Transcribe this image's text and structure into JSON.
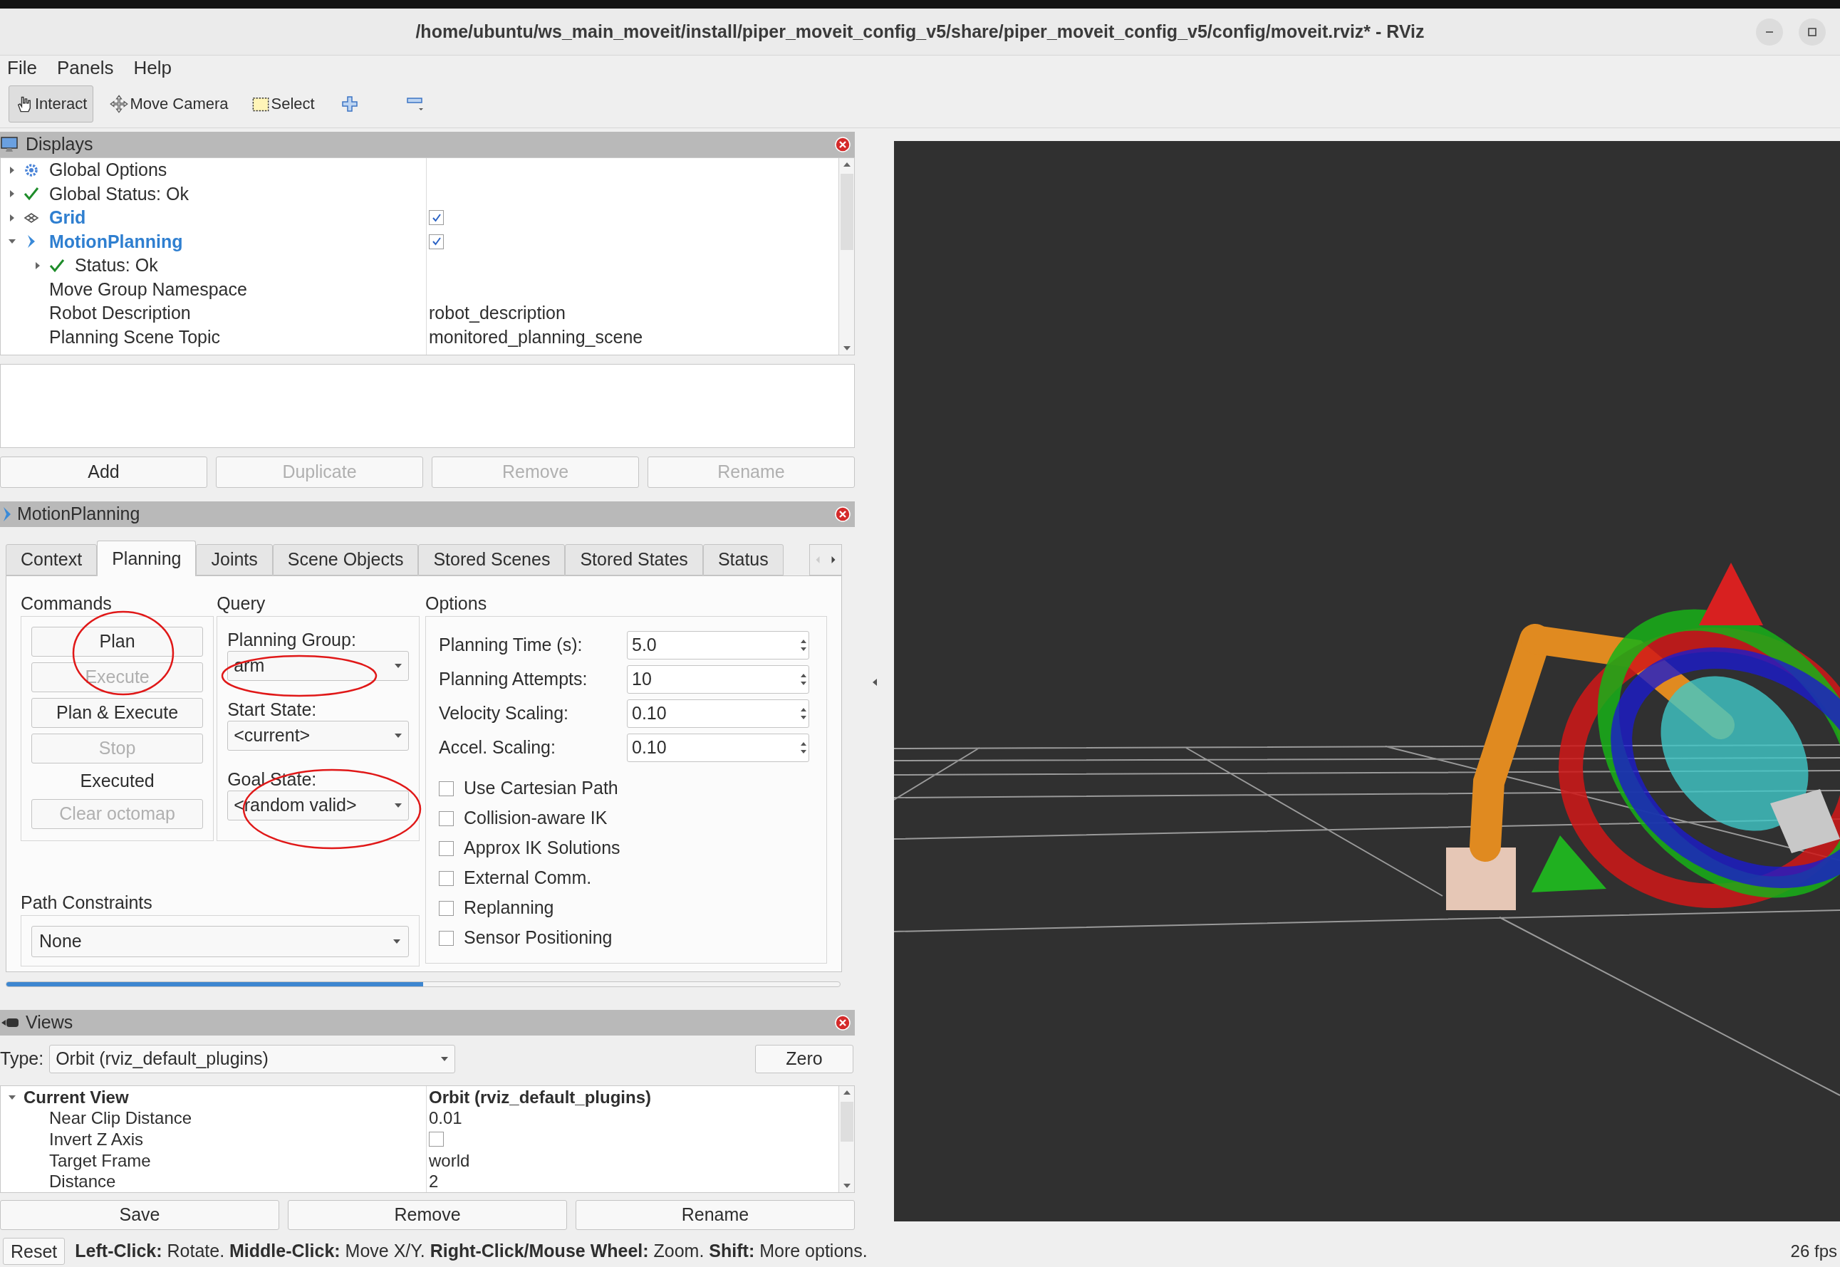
{
  "window": {
    "title": "/home/ubuntu/ws_main_moveit/install/piper_moveit_config_v5/share/piper_moveit_config_v5/config/moveit.rviz* - RViz"
  },
  "menu": [
    "File",
    "Panels",
    "Help"
  ],
  "toolbar": [
    {
      "kind": "interact",
      "label": "Interact",
      "selected": true
    },
    {
      "kind": "move",
      "label": "Move Camera",
      "selected": false
    },
    {
      "kind": "select",
      "label": "Select",
      "selected": false
    },
    {
      "kind": "plus"
    },
    {
      "kind": "minus"
    }
  ],
  "displays": {
    "title": "Displays",
    "tree": [
      {
        "label": "Global Options",
        "kind": "gear",
        "expanded": false
      },
      {
        "label": "Global Status: Ok",
        "kind": "status",
        "expanded": false
      },
      {
        "label": "Grid",
        "kind": "grid",
        "expanded": false,
        "checked": true
      },
      {
        "label": "MotionPlanning",
        "kind": "motion",
        "expanded": true,
        "checked": true,
        "children": [
          {
            "label": "Status: Ok",
            "kind": "status",
            "expanded": false
          },
          {
            "label": "Move Group Namespace"
          },
          {
            "label": "Robot Description",
            "value": "robot_description"
          },
          {
            "label": "Planning Scene Topic",
            "value": "monitored_planning_scene"
          }
        ]
      }
    ],
    "buttons": [
      {
        "label": "Add",
        "disabled": false
      },
      {
        "label": "Duplicate",
        "disabled": true
      },
      {
        "label": "Remove",
        "disabled": true
      },
      {
        "label": "Rename",
        "disabled": true
      }
    ]
  },
  "motion_planning": {
    "title": "MotionPlanning",
    "tabs": [
      {
        "label": "Context",
        "selected": false
      },
      {
        "label": "Planning",
        "selected": true
      },
      {
        "label": "Joints",
        "selected": false
      },
      {
        "label": "Scene Objects",
        "selected": false
      },
      {
        "label": "Stored Scenes",
        "selected": false
      },
      {
        "label": "Stored States",
        "selected": false
      },
      {
        "label": "Status",
        "selected": false
      }
    ],
    "commands": {
      "title": "Commands",
      "items": [
        {
          "kind": "button",
          "label": "Plan",
          "disabled": false
        },
        {
          "kind": "button",
          "label": "Execute",
          "disabled": true
        },
        {
          "kind": "button",
          "label": "Plan & Execute",
          "disabled": false
        },
        {
          "kind": "button",
          "label": "Stop",
          "disabled": true
        },
        {
          "kind": "status",
          "label": "Executed"
        },
        {
          "kind": "button",
          "label": "Clear octomap",
          "disabled": true
        }
      ]
    },
    "query": {
      "title": "Query",
      "fields": [
        {
          "label": "Planning Group:",
          "value": "arm"
        },
        {
          "label": "Start State:",
          "value": "<current>"
        },
        {
          "label": "Goal State:",
          "value": "<random valid>"
        }
      ]
    },
    "options": {
      "title": "Options",
      "spinboxes": [
        {
          "label": "Planning Time (s):",
          "value": "5.0"
        },
        {
          "label": "Planning Attempts:",
          "value": "10"
        },
        {
          "label": "Velocity Scaling:",
          "value": "0.10"
        },
        {
          "label": "Accel. Scaling:",
          "value": "0.10"
        }
      ],
      "checkboxes": [
        {
          "label": "Use Cartesian Path",
          "checked": false
        },
        {
          "label": "Collision-aware IK",
          "checked": false
        },
        {
          "label": "Approx IK Solutions",
          "checked": false
        },
        {
          "label": "External Comm.",
          "checked": false
        },
        {
          "label": "Replanning",
          "checked": false
        },
        {
          "label": "Sensor Positioning",
          "checked": false
        }
      ]
    },
    "path_constraints": {
      "title": "Path Constraints",
      "value": "None"
    },
    "progress": {
      "level": 0.5
    }
  },
  "views": {
    "title": "Views",
    "type_label": "Type:",
    "type_value": "Orbit (rviz_default_plugins)",
    "zero_button": "Zero",
    "tree": [
      {
        "label": "Current View",
        "value": "Orbit (rviz_default_plugins)",
        "expanded": true,
        "children": [
          {
            "label": "Near Clip Distance",
            "value": "0.01"
          },
          {
            "label": "Invert Z Axis",
            "checked": false
          },
          {
            "label": "Target Frame",
            "value": "world"
          },
          {
            "label": "Distance",
            "value": "2"
          }
        ]
      }
    ],
    "buttons": [
      "Save",
      "Remove",
      "Rename"
    ]
  },
  "status_bar": {
    "reset": "Reset",
    "help": "**Left-Click:** Rotate. **Middle-Click:** Move X/Y. **Right-Click/Mouse Wheel:** Zoom. **Shift:** More options.",
    "fps": "26 fps"
  }
}
